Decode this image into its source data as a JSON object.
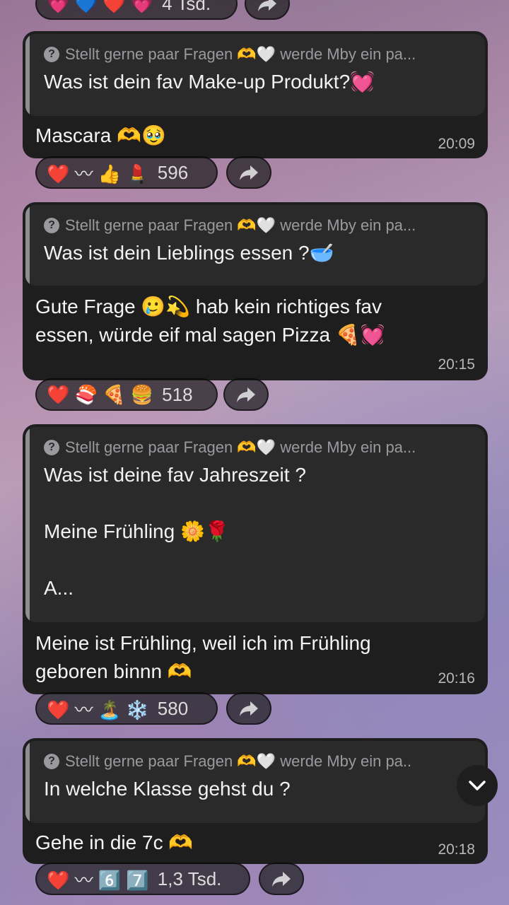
{
  "top_partial": {
    "count": "4 Tsd."
  },
  "messages": [
    {
      "quote_header": "Stellt gerne paar Fragen 🫶🤍 werde Mby ein pa...",
      "quote_text": "Was ist dein fav Make-up Produkt?💓",
      "answer": "Mascara 🫶🥹",
      "time": "20:09",
      "reactions": "❤️ 〰 👍 💄",
      "count": "596"
    },
    {
      "quote_header": "Stellt gerne paar Fragen 🫶🤍 werde Mby ein pa...",
      "quote_text": "Was ist dein Lieblings essen ?🥣",
      "answer": "Gute Frage 🥲💫 hab kein richtiges fav\nessen, würde eif mal sagen Pizza 🍕💓",
      "time": "20:15",
      "reactions": "❤️ 🍣 🍕 🍔",
      "count": "518"
    },
    {
      "quote_header": "Stellt gerne paar Fragen 🫶🤍 werde Mby ein pa...",
      "quote_text": "Was ist deine fav Jahreszeit ?\n\nMeine Frühling 🌼🌹\n\nA...",
      "answer": "Meine ist Frühling, weil ich im Frühling\ngeboren binnn 🫶",
      "time": "20:16",
      "reactions": "❤️ 〰 🏝️ ❄️",
      "count": "580"
    },
    {
      "quote_header": "Stellt gerne paar Fragen 🫶🤍 werde Mby ein pa..",
      "quote_text": "In welche Klasse gehst du ?",
      "answer": "Gehe in die 7c 🫶",
      "time": "20:18",
      "reactions": "❤️ 〰 6️⃣ 7️⃣",
      "count": "1,3 Tsd."
    }
  ]
}
